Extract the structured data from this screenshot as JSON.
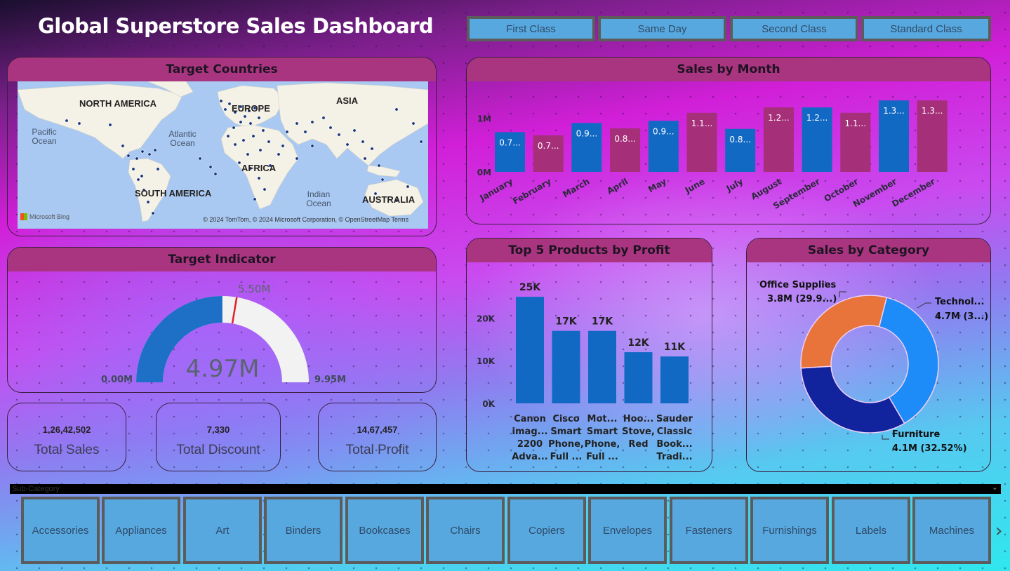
{
  "dashboard": {
    "title": "Global Superstore Sales Dashboard"
  },
  "ship_mode_slicer": {
    "options": [
      "First Class",
      "Same Day",
      "Second Class",
      "Standard Class"
    ]
  },
  "map_panel": {
    "title": "Target Countries",
    "continents": [
      "NORTH AMERICA",
      "EUROPE",
      "ASIA",
      "AFRICA",
      "SOUTH AMERICA",
      "AUSTRALIA"
    ],
    "oceans": [
      "Pacific Ocean",
      "Atlantic Ocean",
      "Indian Ocean"
    ],
    "attribution": "© 2024 TomTom, © 2024 Microsoft Corporation, © OpenStreetMap  Terms",
    "logo": "Microsoft Bing"
  },
  "gauge_panel": {
    "title": "Target Indicator",
    "value_label": "4.97M",
    "min_label": "0.00M",
    "max_label": "9.95M",
    "target_label": "5.50M"
  },
  "kpis": [
    {
      "value": "1,26,42,502",
      "label": "Total Sales"
    },
    {
      "value": "7,330",
      "label": "Total Discount"
    },
    {
      "value": "14,67,457",
      "label": "Total Profit"
    }
  ],
  "sub_category": {
    "label": "Sub-Category",
    "items": [
      "Accessories",
      "Appliances",
      "Art",
      "Binders",
      "Bookcases",
      "Chairs",
      "Copiers",
      "Envelopes",
      "Fasteners",
      "Furnishings",
      "Labels",
      "Machines"
    ],
    "next_glyph": "›"
  },
  "colors": {
    "bar_blue": "#1269c4",
    "bar_magenta": "#a52f78",
    "panel_header": "#a93580",
    "gauge_fill": "#1e6fc6",
    "gauge_bg": "#f2f2f2",
    "gauge_target": "#e0202a",
    "donut_office": "#e8743b",
    "donut_tech": "#1d8cf8",
    "donut_furniture": "#12239e",
    "slicer_fill": "#58a8e0"
  },
  "chart_data": [
    {
      "id": "sales_by_month",
      "type": "bar",
      "title": "Sales by Month",
      "categories": [
        "January",
        "February",
        "March",
        "April",
        "May",
        "June",
        "July",
        "August",
        "September",
        "October",
        "November",
        "December"
      ],
      "values": [
        0.74,
        0.68,
        0.91,
        0.81,
        0.95,
        1.1,
        0.8,
        1.2,
        1.2,
        1.1,
        1.33,
        1.33
      ],
      "data_labels": [
        "0.7...",
        "0.7...",
        "0.9...",
        "0.8...",
        "0.9...",
        "1.1...",
        "0.8...",
        "1.2...",
        "1.2...",
        "1.1...",
        "1.3...",
        "1.3..."
      ],
      "y_ticks": [
        "0M",
        "1M"
      ],
      "ylim": [
        0,
        1.45
      ],
      "grid": false
    },
    {
      "id": "top5_products_profit",
      "type": "bar",
      "title": "Top 5 Products by Profit",
      "categories": [
        [
          "Canon",
          "imag...",
          "2200",
          "Adva..."
        ],
        [
          "Cisco",
          "Smart",
          "Phone,",
          "Full ..."
        ],
        [
          "Mot...",
          "Smart",
          "Phone,",
          "Full ..."
        ],
        [
          "Hoo...",
          "Stove,",
          "Red"
        ],
        [
          "Sauder",
          "Classic",
          "Book...",
          "Tradi..."
        ]
      ],
      "values": [
        25,
        17,
        17,
        12,
        11
      ],
      "data_labels": [
        "25K",
        "17K",
        "17K",
        "12K",
        "11K"
      ],
      "y_ticks": [
        "0K",
        "10K",
        "20K"
      ],
      "ylim": [
        0,
        26.5
      ],
      "grid": false
    },
    {
      "id": "sales_by_category",
      "type": "pie",
      "title": "Sales by Category",
      "labels": [
        "Technology",
        "Furniture",
        "Office Supplies"
      ],
      "values": [
        37.58,
        32.52,
        29.9
      ],
      "data_labels": [
        [
          "Technol...",
          "4.7M (3...)"
        ],
        [
          "Furniture",
          "4.1M (32.52%)"
        ],
        [
          "Office Supplies",
          "3.8M (29.9...)"
        ]
      ],
      "donut": true
    }
  ]
}
